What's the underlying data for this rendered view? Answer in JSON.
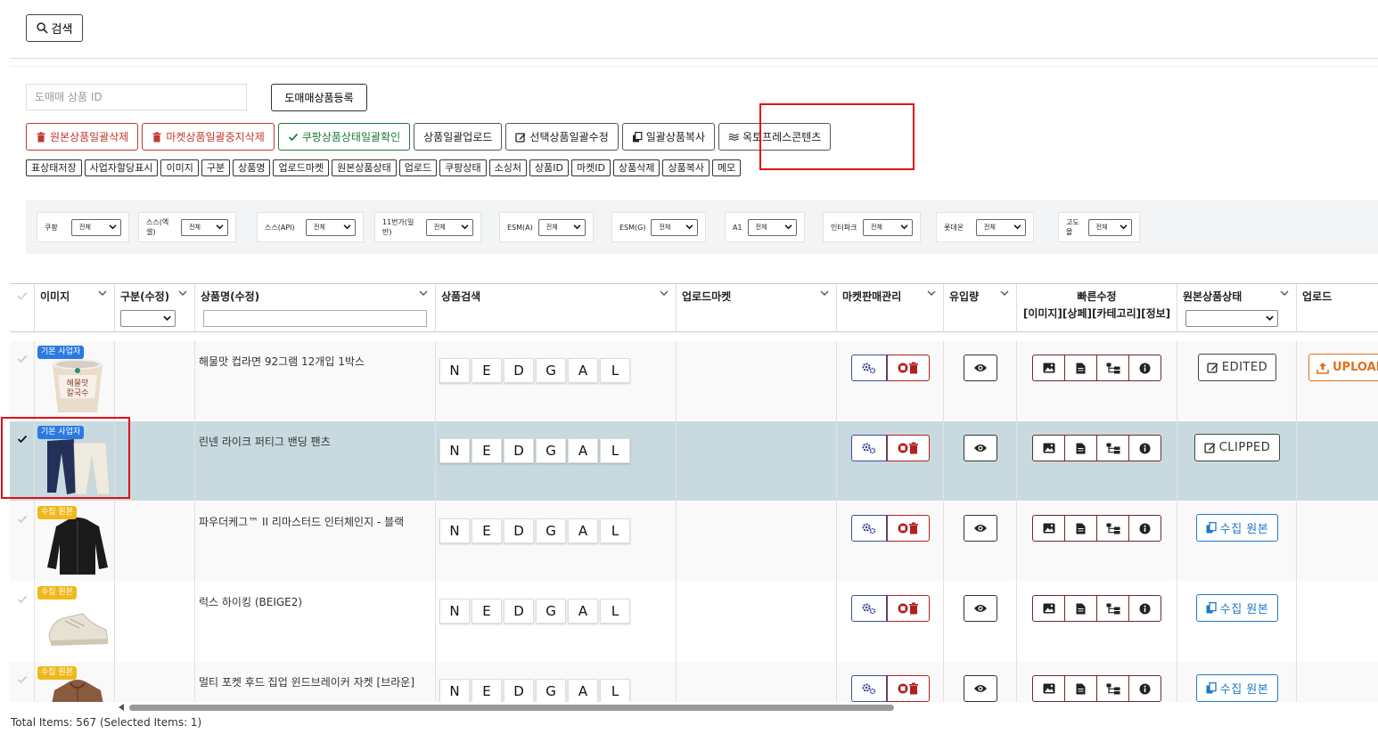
{
  "search": {
    "button_label": "검색"
  },
  "register": {
    "input_placeholder": "도매매 상품 ID",
    "button_label": "도매매상품등록"
  },
  "actions": [
    {
      "label": "원본상품일괄삭제",
      "style": "red",
      "icon": "trash-icon"
    },
    {
      "label": "마켓상품일괄중지삭제",
      "style": "red",
      "icon": "trash-icon"
    },
    {
      "label": "쿠팡상품상태일괄확인",
      "style": "green",
      "icon": "check-icon"
    },
    {
      "label": "상품일괄업로드",
      "style": "plain",
      "icon": ""
    },
    {
      "label": "선택상품일괄수정",
      "style": "plain",
      "icon": "edit-icon"
    },
    {
      "label": "일괄상품복사",
      "style": "plain",
      "icon": "copy-icon"
    },
    {
      "label": "옥토프레스콘텐츠",
      "style": "plain",
      "icon": "waves-icon"
    }
  ],
  "chips": [
    "표상태저장",
    "사업자할당표시",
    "이미지",
    "구분",
    "상품명",
    "업로드마켓",
    "원본상품상태",
    "업로드",
    "쿠팡상태",
    "소싱처",
    "상품ID",
    "마켓ID",
    "상품삭제",
    "상품복사",
    "메모"
  ],
  "filters": [
    {
      "label": "쿠팡",
      "value": "전체"
    },
    {
      "label": "스스(엑셀)",
      "value": "전체"
    },
    {
      "label": "스스(API)",
      "value": "전체"
    },
    {
      "label": "11번가(일반)",
      "value": "전체"
    },
    {
      "label": "ESM(A)",
      "value": "전체"
    },
    {
      "label": "ESM(G)",
      "value": "전체"
    },
    {
      "label": "A1",
      "value": "전체"
    },
    {
      "label": "인터파크",
      "value": "전체"
    },
    {
      "label": "롯데온",
      "value": "전체"
    },
    {
      "label": "고도몰",
      "value": "전체"
    }
  ],
  "columns": {
    "image": "이미지",
    "category": "구분(수정)",
    "name": "상품명(수정)",
    "search": "상품검색",
    "upload_market": "업로드마켓",
    "market_mgmt": "마켓판매관리",
    "traffic": "유입량",
    "quick_edit_1": "빠른수정",
    "quick_edit_2": "[이미지][상페][카테고리][정보]",
    "origin_status": "원본상품상태",
    "upload": "업로드"
  },
  "search_letters": [
    "N",
    "E",
    "D",
    "G",
    "A",
    "L"
  ],
  "rows": [
    {
      "badge": "기본 사업자",
      "badge_color": "blue",
      "name": "해물맛 컵라면 92그램 12개입 1박스",
      "status": "EDITED",
      "status_style": "plain",
      "upload": "UPLOAD",
      "selected": false,
      "thumb": "noodle-cup"
    },
    {
      "badge": "기본 사업자",
      "badge_color": "blue",
      "name": "린넨 라이크 퍼티그 밴딩 팬츠",
      "status": "CLIPPED",
      "status_style": "plain",
      "upload": "",
      "selected": true,
      "thumb": "pants"
    },
    {
      "badge": "수집 원본",
      "badge_color": "yellow",
      "name": "파우더케그™ II 리마스터드 인터체인지 - 블랙",
      "status": "수집 원본",
      "status_style": "blue",
      "upload": "",
      "selected": false,
      "thumb": "jacket"
    },
    {
      "badge": "수집 원본",
      "badge_color": "yellow",
      "name": "럭스 하이킹 (BEIGE2)",
      "status": "수집 원본",
      "status_style": "blue",
      "upload": "",
      "selected": false,
      "thumb": "shoe"
    },
    {
      "badge": "수집 원본",
      "badge_color": "yellow",
      "name": "멀티 포켓 후드 집업 윈드브레이커 자켓 [브라운]",
      "status": "수집 원본",
      "status_style": "blue",
      "upload": "",
      "selected": false,
      "thumb": "brown-jacket"
    }
  ],
  "thumb_text": {
    "noodle_line1": "해물맛",
    "noodle_line2": "칼국수"
  },
  "footer": {
    "total_text": "Total Items: 567 (Selected Items: 1)"
  }
}
